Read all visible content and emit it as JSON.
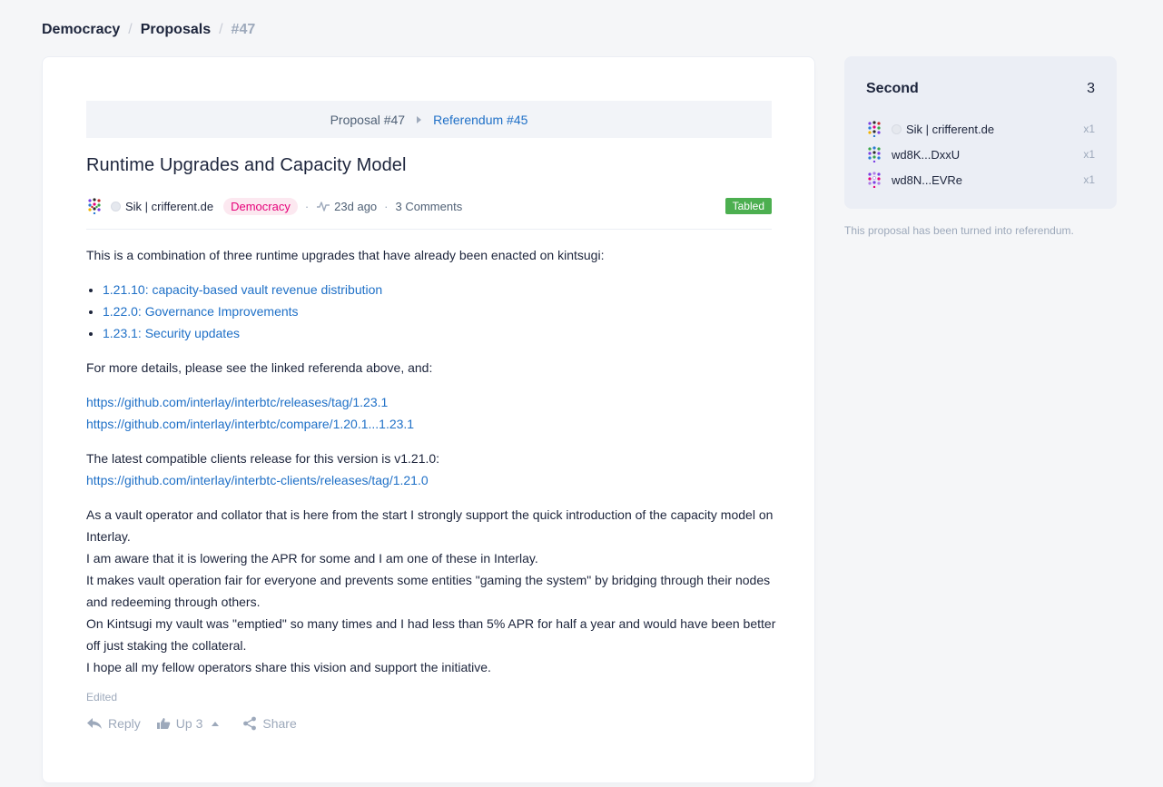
{
  "breadcrumb": {
    "items": [
      "Democracy",
      "Proposals",
      "#47"
    ],
    "separator": "/"
  },
  "timeline": {
    "proposal": "Proposal #47",
    "referendum": "Referendum #45"
  },
  "post": {
    "title": "Runtime Upgrades and Capacity Model",
    "author": "Sik | crifferent.de",
    "category": "Democracy",
    "time": "23d ago",
    "comments": "3 Comments",
    "status": "Tabled",
    "intro": "This is a combination of three runtime upgrades that have already been enacted on kintsugi:",
    "upgrades": [
      "1.21.10: capacity-based vault revenue distribution",
      "1.22.0: Governance Improvements",
      "1.23.1: Security updates"
    ],
    "details_text": "For more details, please see the linked referenda above, and:",
    "links": [
      "https://github.com/interlay/interbtc/releases/tag/1.23.1",
      "https://github.com/interlay/interbtc/compare/1.20.1...1.23.1"
    ],
    "clients_text": "The latest compatible clients release for this version is v1.21.0:",
    "clients_link": "https://github.com/interlay/interbtc-clients/releases/tag/1.21.0",
    "comment_lines": [
      "As a vault operator and collator that is here from the start I strongly support the quick introduction of the capacity model on Interlay.",
      "I am aware that it is lowering the APR for some and I am one of these in Interlay.",
      "It makes vault operation fair for everyone and prevents some entities \"gaming the system\" by bridging through their nodes and redeeming through others.",
      "On Kintsugi my vault was \"emptied\" so many times and I had less than 5% APR for half a year and would have been better off just staking the collateral.",
      "I hope all my fellow operators share this vision and support the initiative."
    ],
    "edited": "Edited",
    "actions": {
      "reply": "Reply",
      "up": "Up 3",
      "share": "Share"
    }
  },
  "second": {
    "label": "Second",
    "count": "3",
    "seconders": [
      {
        "name": "Sik | crifferent.de",
        "times": "x1",
        "has_identity": true
      },
      {
        "name": "wd8K...DxxU",
        "times": "x1",
        "has_identity": false
      },
      {
        "name": "wd8N...EVRe",
        "times": "x1",
        "has_identity": false
      }
    ]
  },
  "side_note": "This proposal has been turned into referendum.",
  "colors": {
    "link": "#1f70c7",
    "status_tabled": "#4caf50",
    "tag_pink": "#e6007a",
    "muted": "#9da9bb"
  }
}
